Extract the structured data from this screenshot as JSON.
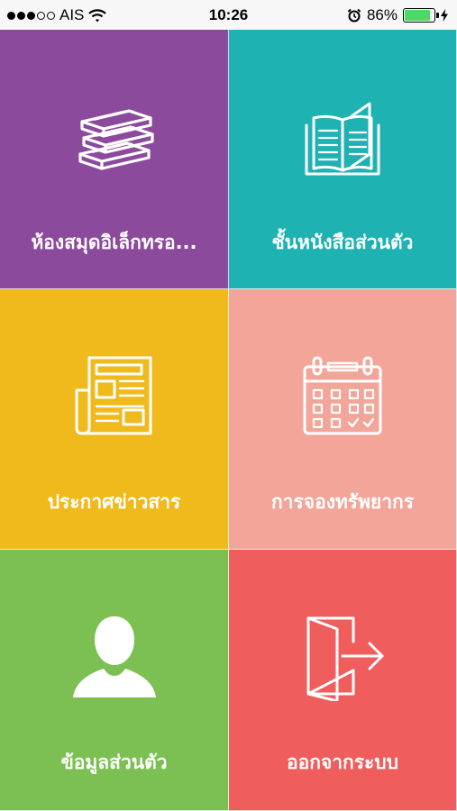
{
  "status_bar": {
    "carrier": "AIS",
    "time": "10:26",
    "battery_percent": "86%",
    "battery_level": 0.86,
    "icons": [
      "signal-dots-icon",
      "wifi-icon",
      "alarm-icon",
      "battery-icon",
      "charging-bolt-icon"
    ]
  },
  "tiles": [
    {
      "label": "ห้องสมุดอิเล็กทรอ...",
      "icon": "books-stack-icon",
      "color": "#8b4a9c"
    },
    {
      "label": "ชั้นหนังสือส่วนตัว",
      "icon": "open-book-icon",
      "color": "#1fb2b2"
    },
    {
      "label": "ประกาศข่าวสาร",
      "icon": "newspaper-icon",
      "color": "#f0b91c"
    },
    {
      "label": "การจองทรัพยากร",
      "icon": "calendar-icon",
      "color": "#f2a598"
    },
    {
      "label": "ข้อมูลส่วนตัว",
      "icon": "user-profile-icon",
      "color": "#7cbf52"
    },
    {
      "label": "ออกจากระบบ",
      "icon": "logout-door-icon",
      "color": "#f05d5d"
    }
  ]
}
